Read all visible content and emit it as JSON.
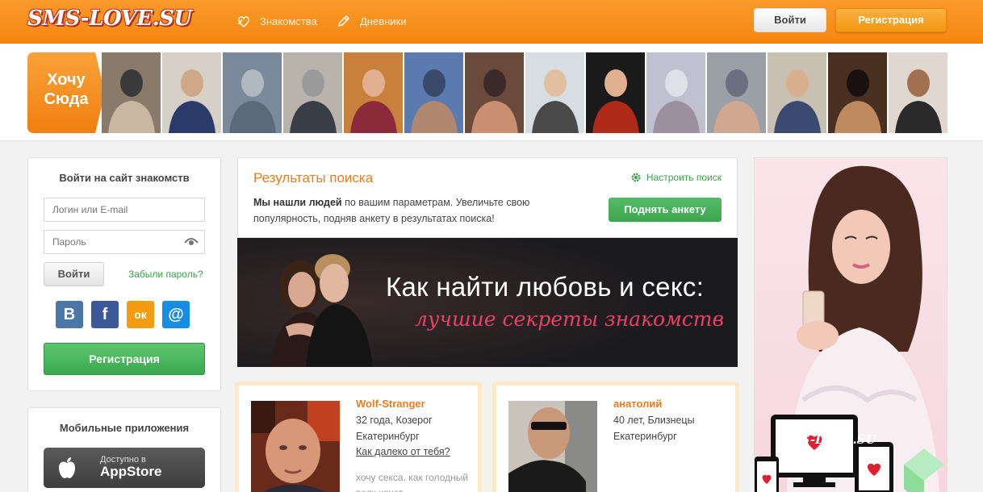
{
  "header": {
    "logo": "SMS-LOVE.SU",
    "nav": [
      {
        "label": "Знакомства",
        "icon": "hearts-icon"
      },
      {
        "label": "Дневники",
        "icon": "pencil-icon"
      }
    ],
    "login_button": "Войти",
    "register_button": "Регистрация"
  },
  "strip": {
    "want_here": [
      "Хочу",
      "Сюда"
    ],
    "thumbs": [
      {
        "colors": [
          "#8a7a6a",
          "#c9b7a2",
          "#3a3a3a"
        ]
      },
      {
        "colors": [
          "#d6d0c6",
          "#2a3a6a",
          "#cfa88a"
        ]
      },
      {
        "colors": [
          "#7a8a9a",
          "#5a6a7a",
          "#b0b8c0"
        ]
      },
      {
        "colors": [
          "#b8b4ac",
          "#3a3e48",
          "#9a9a9a"
        ]
      },
      {
        "colors": [
          "#c8803a",
          "#8a2a3a",
          "#e0b090"
        ]
      },
      {
        "colors": [
          "#5a7ab0",
          "#b08870",
          "#3a4a6a"
        ]
      },
      {
        "colors": [
          "#6a4a3a",
          "#c89070",
          "#3a2a2a"
        ]
      },
      {
        "colors": [
          "#d8dde2",
          "#4a4a4a",
          "#e0c0a0"
        ]
      },
      {
        "colors": [
          "#1a1a1a",
          "#b02a1a",
          "#e0b090"
        ]
      },
      {
        "colors": [
          "#c0c0d0",
          "#9a90a0",
          "#e0e0e8"
        ]
      },
      {
        "colors": [
          "#9aa0a6",
          "#d0a890",
          "#6a7080"
        ]
      },
      {
        "colors": [
          "#c8c0b0",
          "#3a4a70",
          "#d8b090"
        ]
      },
      {
        "colors": [
          "#4a3020",
          "#c08a60",
          "#1a1010"
        ]
      },
      {
        "colors": [
          "#e0d8d0",
          "#2a2a2a",
          "#a07050"
        ]
      }
    ]
  },
  "login": {
    "title": "Войти на сайт знакомств",
    "login_placeholder": "Логин или E-mail",
    "password_placeholder": "Пароль",
    "login_button": "Войти",
    "forgot_link": "Забыли пароль?",
    "socials": [
      {
        "name": "vk-icon",
        "glyph": "В",
        "color": "#4a76a8"
      },
      {
        "name": "facebook-icon",
        "glyph": "f",
        "color": "#3b5998"
      },
      {
        "name": "odnoklassniki-icon",
        "glyph": "ок",
        "color": "#f39c12"
      },
      {
        "name": "mailru-icon",
        "glyph": "@",
        "color": "#168de2"
      }
    ],
    "register_button": "Регистрация"
  },
  "apps": {
    "title": "Мобильные приложения",
    "appstore_small": "Доступно в",
    "appstore_big": "AppStore"
  },
  "results": {
    "title": "Результаты поиска",
    "tune_link": "Настроить поиск",
    "text_bold": "Мы нашли людей",
    "text_rest": " по вашим параметрам. Увеличьте свою популярность, подняв анкету в результатах поиска!",
    "raise_button": "Поднять анкету"
  },
  "banner": {
    "line1": "Как найти любовь и секс:",
    "line2": "лучшие секреты знакомств"
  },
  "cards": [
    {
      "name": "Wolf-Stranger",
      "age_sign": "32 года, Козерог",
      "city": "Екатеринбург",
      "link": "Как далеко от тебя?",
      "quote": "хочу секса. как голодный волк хочет"
    },
    {
      "name": "анатолий",
      "age_sign": "40 лет, Близнецы",
      "city": "Екатеринбург"
    }
  ],
  "ad": {
    "logo": "SMS-LOVE.SU"
  }
}
